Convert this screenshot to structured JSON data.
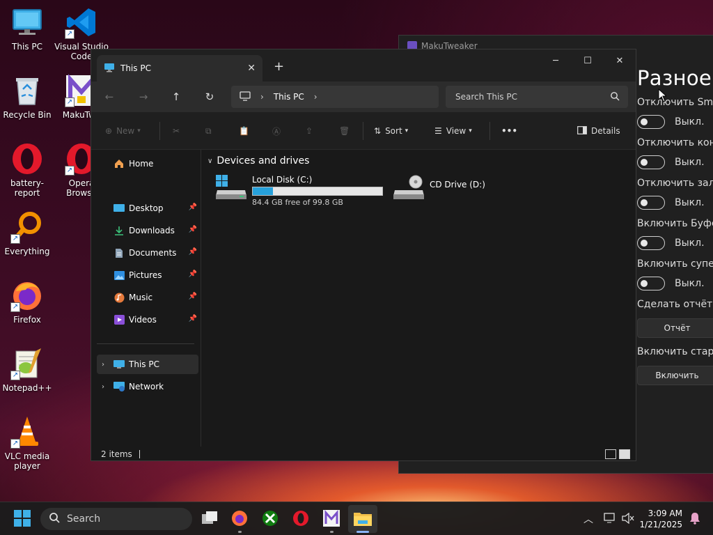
{
  "desktop": {
    "icons": [
      {
        "label": "This PC"
      },
      {
        "label": "Visual Studio Code"
      },
      {
        "label": "Recycle Bin"
      },
      {
        "label": "MakuTwe"
      },
      {
        "label": "battery-report"
      },
      {
        "label": "Opera Browse"
      },
      {
        "label": "Everything"
      },
      {
        "label": "Firefox"
      },
      {
        "label": "Notepad++"
      },
      {
        "label": "VLC media player"
      }
    ]
  },
  "maku": {
    "title": "MakuTweaker",
    "heading": "Разное",
    "options": [
      {
        "label": "Отключить Sma",
        "state": "Выкл."
      },
      {
        "label": "Отключить кон",
        "state": "Выкл."
      },
      {
        "label": "Отключить зал",
        "state": "Выкл."
      },
      {
        "label": "Включить Буфе",
        "state": "Выкл."
      },
      {
        "label": "Включить супер",
        "state": "Выкл."
      }
    ],
    "report_label": "Сделать отчёт о",
    "report_button": "Отчёт",
    "old_label": "Включить стары",
    "old_button": "Включить"
  },
  "explorer": {
    "tab_title": "This PC",
    "new_tab": "+",
    "address": "This PC",
    "search_placeholder": "Search This PC",
    "commands": {
      "new": "New",
      "sort": "Sort",
      "view": "View",
      "more": "•••",
      "details": "Details"
    },
    "sidebar": {
      "home": "Home",
      "pinned": [
        {
          "label": "Desktop"
        },
        {
          "label": "Downloads"
        },
        {
          "label": "Documents"
        },
        {
          "label": "Pictures"
        },
        {
          "label": "Music"
        },
        {
          "label": "Videos"
        }
      ],
      "this_pc": "This PC",
      "network": "Network"
    },
    "group_header": "Devices and drives",
    "drives": [
      {
        "name": "Local Disk (C:)",
        "free_text": "84.4 GB free of 99.8 GB",
        "used_fraction": 0.154
      },
      {
        "name": "CD Drive (D:)"
      }
    ],
    "status": "2 items"
  },
  "taskbar": {
    "search_label": "Search",
    "time": "3:09 AM",
    "date": "1/21/2025"
  },
  "colors": {
    "accent": "#26a0da",
    "window_bg": "#191919",
    "opera_red": "#e3192b",
    "vscode_blue": "#0078d4"
  }
}
